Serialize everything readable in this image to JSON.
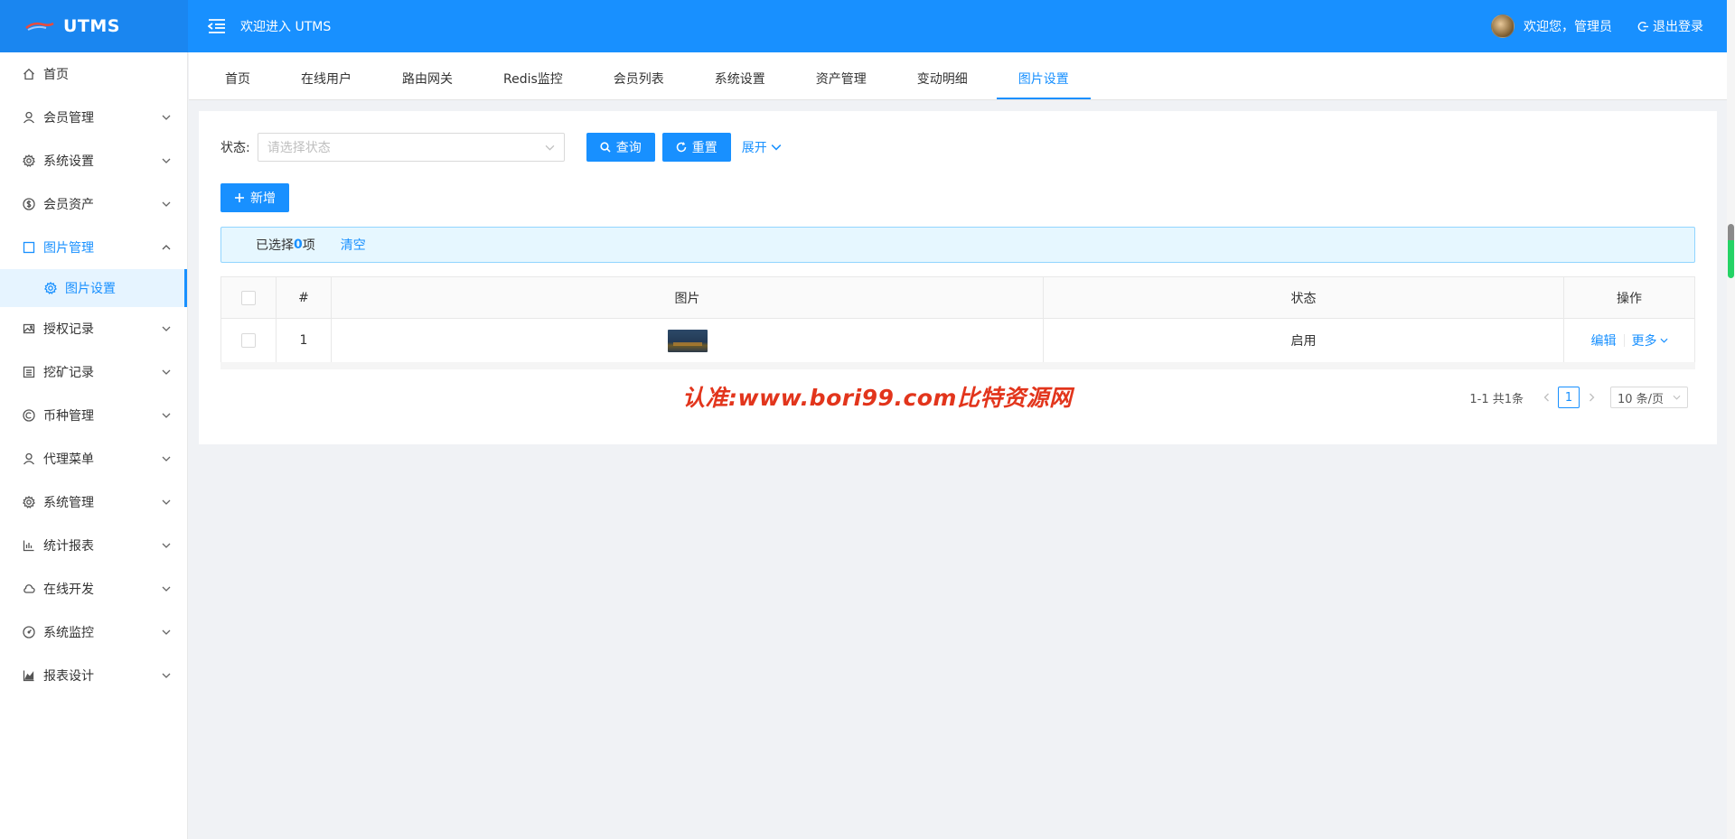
{
  "header": {
    "logo_text": "UTMS",
    "welcome": "欢迎进入 UTMS",
    "user_greeting": "欢迎您，管理员",
    "logout_label": "退出登录",
    "brand_color": "#1890ff"
  },
  "sidebar": {
    "items": [
      {
        "label": "首页",
        "icon": "home-icon"
      },
      {
        "label": "会员管理",
        "icon": "user-icon"
      },
      {
        "label": "系统设置",
        "icon": "gear-icon"
      },
      {
        "label": "会员资产",
        "icon": "dollar-icon"
      },
      {
        "label": "图片管理",
        "icon": "square-icon"
      },
      {
        "label": "图片设置",
        "icon": "gear-icon"
      },
      {
        "label": "授权记录",
        "icon": "picture-icon"
      },
      {
        "label": "挖矿记录",
        "icon": "list-icon"
      },
      {
        "label": "币种管理",
        "icon": "copyright-icon"
      },
      {
        "label": "代理菜单",
        "icon": "user-icon"
      },
      {
        "label": "系统管理",
        "icon": "gear-icon"
      },
      {
        "label": "统计报表",
        "icon": "bar-chart-icon"
      },
      {
        "label": "在线开发",
        "icon": "cloud-icon"
      },
      {
        "label": "系统监控",
        "icon": "dashboard-icon"
      },
      {
        "label": "报表设计",
        "icon": "area-chart-icon"
      }
    ]
  },
  "tabs": [
    {
      "label": "首页"
    },
    {
      "label": "在线用户"
    },
    {
      "label": "路由网关"
    },
    {
      "label": "Redis监控"
    },
    {
      "label": "会员列表"
    },
    {
      "label": "系统设置"
    },
    {
      "label": "资产管理"
    },
    {
      "label": "变动明细"
    },
    {
      "label": "图片设置",
      "active": true
    }
  ],
  "filter": {
    "status_label": "状态:",
    "status_placeholder": "请选择状态",
    "query_label": "查询",
    "reset_label": "重置",
    "expand_label": "展开"
  },
  "toolbar": {
    "add_label": "新增"
  },
  "selection": {
    "prefix": "已选择",
    "count": "0",
    "suffix": "项",
    "clear_label": "清空"
  },
  "table": {
    "columns": [
      "#",
      "图片",
      "状态",
      "操作"
    ],
    "rows": [
      {
        "index": "1",
        "status": "启用",
        "edit_label": "编辑",
        "more_label": "更多"
      }
    ]
  },
  "watermark": "认准:www.bori99.com比特资源网",
  "pagination": {
    "total_text": "1-1 共1条",
    "current_page": "1",
    "page_size": "10 条/页"
  }
}
